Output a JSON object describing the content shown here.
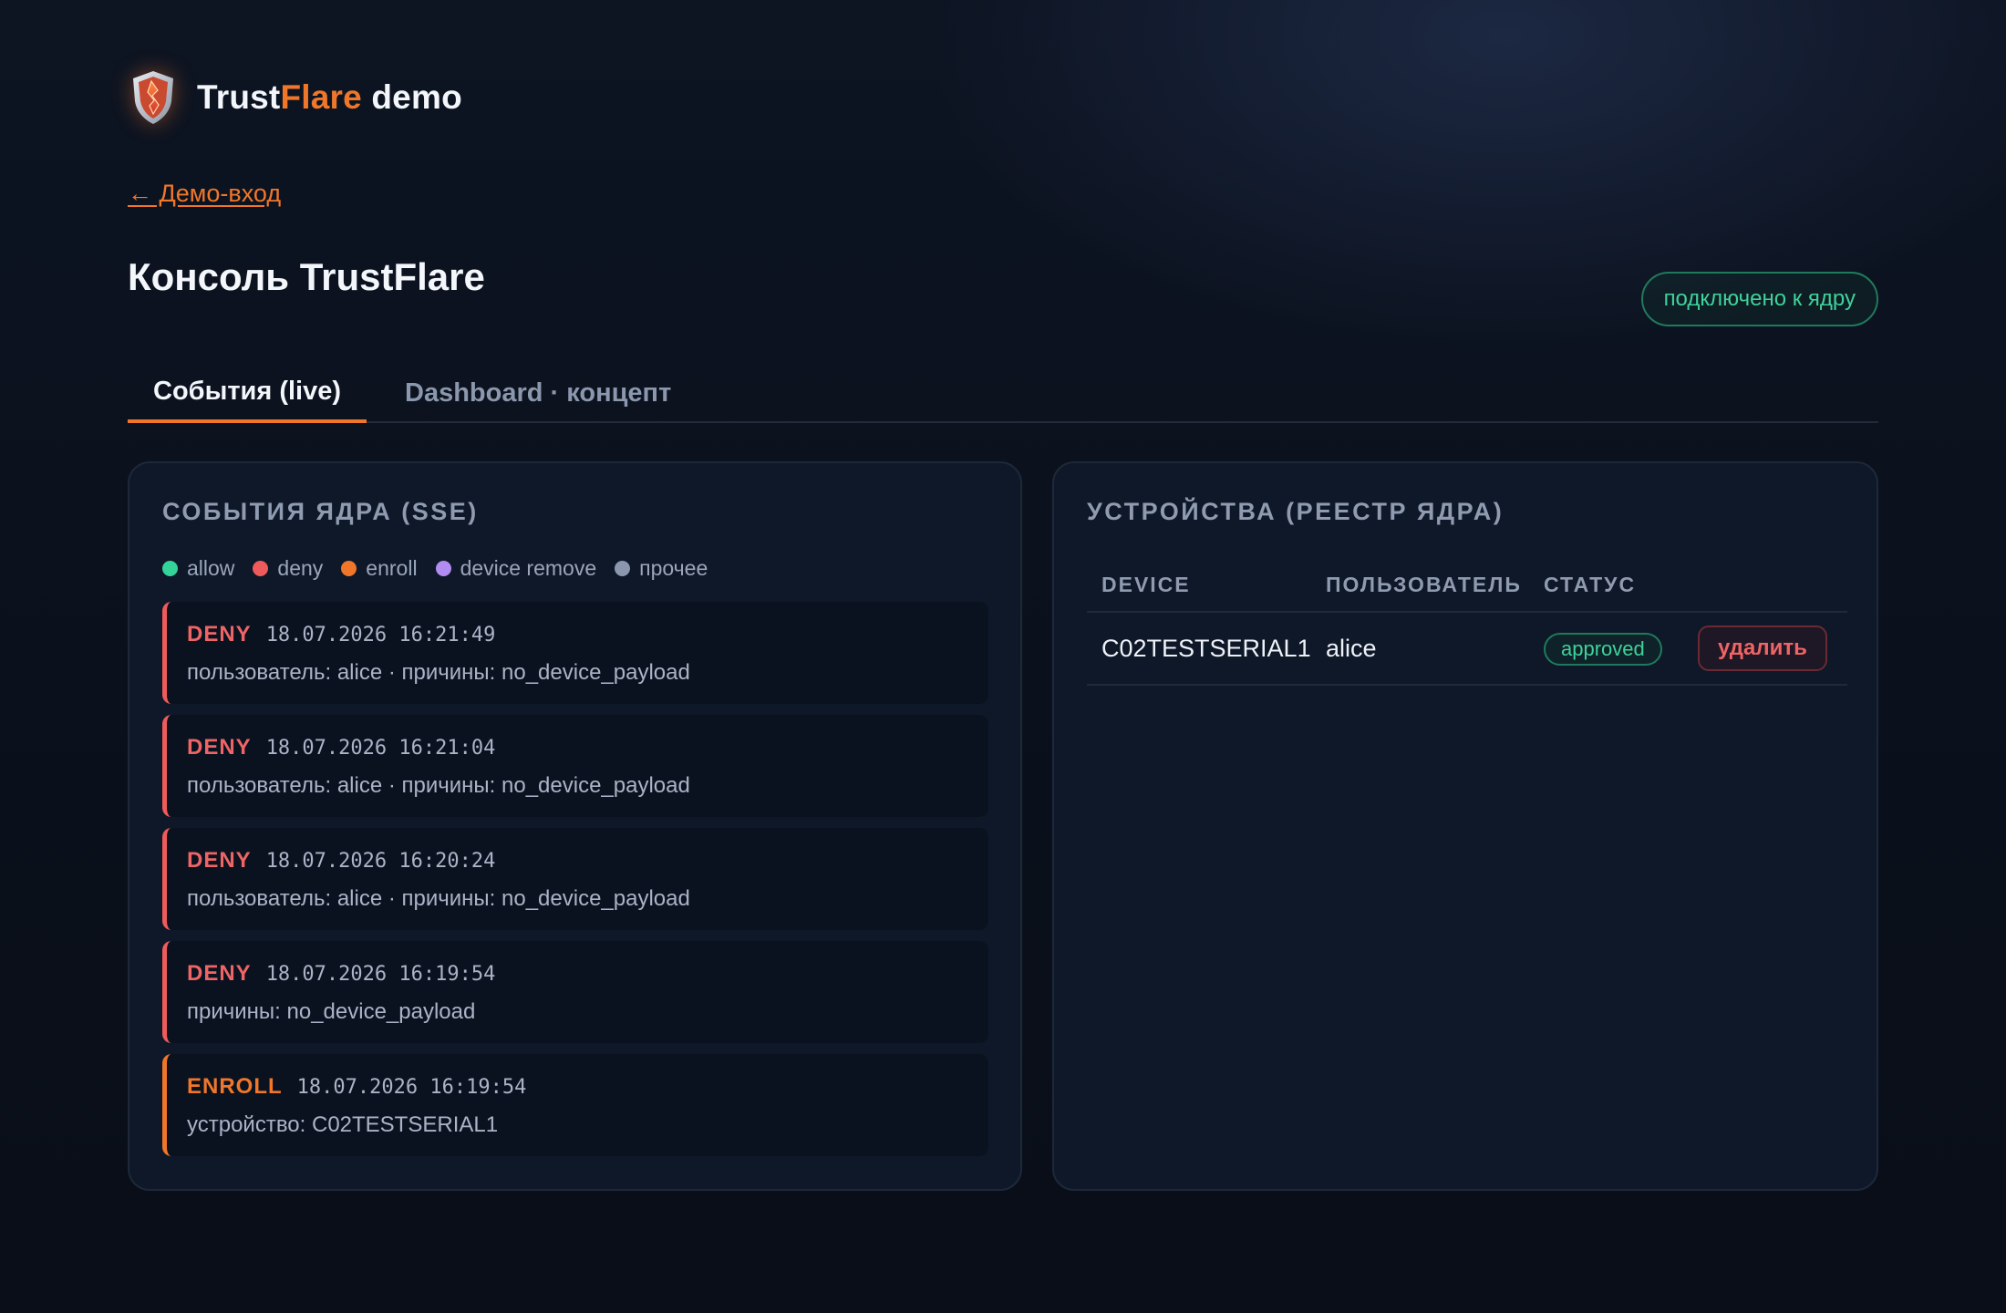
{
  "brand": {
    "name_part1": "Trust",
    "name_part2": "Flare",
    "name_part3": " demo"
  },
  "nav": {
    "back_link": "← Демо-вход"
  },
  "header": {
    "title": "Консоль TrustFlare",
    "connection_status": "подключено к ядру"
  },
  "tabs": [
    {
      "label": "События (live)",
      "active": true
    },
    {
      "label": "Dashboard · концепт",
      "active": false
    }
  ],
  "events_panel": {
    "title": "СОБЫТИЯ ЯДРА (SSE)",
    "legend": [
      {
        "label": "allow",
        "color": "#34d399"
      },
      {
        "label": "deny",
        "color": "#ef5b5b"
      },
      {
        "label": "enroll",
        "color": "#f0772a"
      },
      {
        "label": "device remove",
        "color": "#b18cf2"
      },
      {
        "label": "прочее",
        "color": "#8a97ad"
      }
    ],
    "events": [
      {
        "type": "DENY",
        "time": "18.07.2026 16:21:49",
        "detail": "пользователь: alice · причины: no_device_payload"
      },
      {
        "type": "DENY",
        "time": "18.07.2026 16:21:04",
        "detail": "пользователь: alice · причины: no_device_payload"
      },
      {
        "type": "DENY",
        "time": "18.07.2026 16:20:24",
        "detail": "пользователь: alice · причины: no_device_payload"
      },
      {
        "type": "DENY",
        "time": "18.07.2026 16:19:54",
        "detail": "причины: no_device_payload"
      },
      {
        "type": "ENROLL",
        "time": "18.07.2026 16:19:54",
        "detail": "устройство: C02TESTSERIAL1"
      }
    ]
  },
  "devices_panel": {
    "title": "УСТРОЙСТВА (РЕЕСТР ЯДРА)",
    "columns": [
      "DEVICE",
      "ПОЛЬЗОВАТЕЛЬ",
      "СТАТУС"
    ],
    "rows": [
      {
        "device": "C02TESTSERIAL1",
        "user": "alice",
        "status": "approved",
        "action": "удалить"
      }
    ]
  }
}
